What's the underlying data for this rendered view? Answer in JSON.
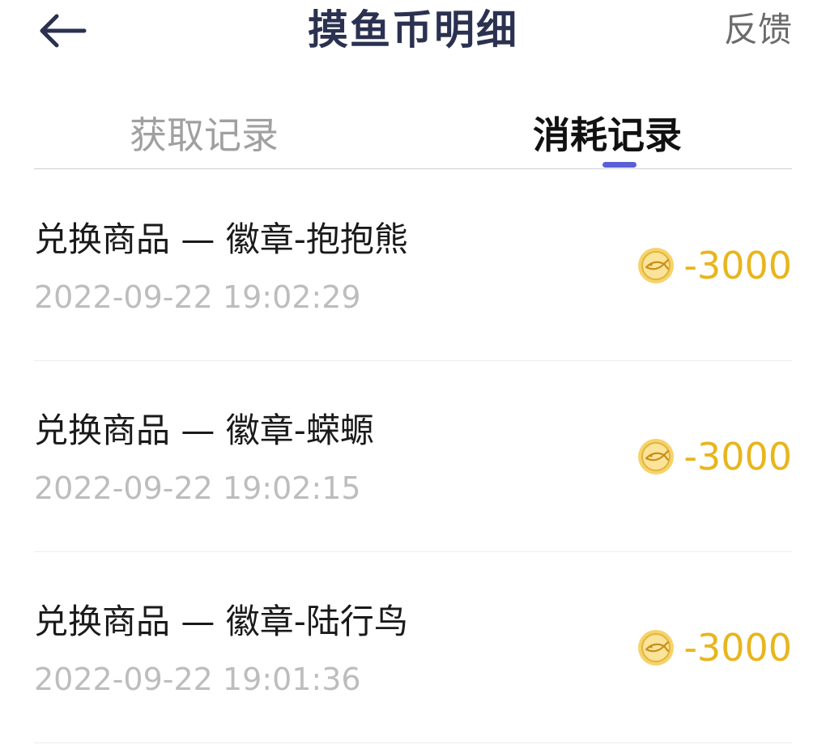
{
  "header": {
    "title": "摸鱼币明细",
    "feedback_label": "反馈",
    "back_icon": "back-arrow-icon"
  },
  "tabs": [
    {
      "label": "获取记录",
      "active": false
    },
    {
      "label": "消耗记录",
      "active": true
    }
  ],
  "colors": {
    "title": "#2b3150",
    "accent": "#5a5fd6",
    "coin": "#e8b51c",
    "muted": "#bdbdbd"
  },
  "records": [
    {
      "title": "兑换商品 — 徽章-抱抱熊",
      "time": "2022-09-22 19:02:29",
      "amount": "-3000",
      "icon": "coin-icon"
    },
    {
      "title": "兑换商品 — 徽章-蝾螈",
      "time": "2022-09-22 19:02:15",
      "amount": "-3000",
      "icon": "coin-icon"
    },
    {
      "title": "兑换商品 — 徽章-陆行鸟",
      "time": "2022-09-22 19:01:36",
      "amount": "-3000",
      "icon": "coin-icon"
    }
  ]
}
